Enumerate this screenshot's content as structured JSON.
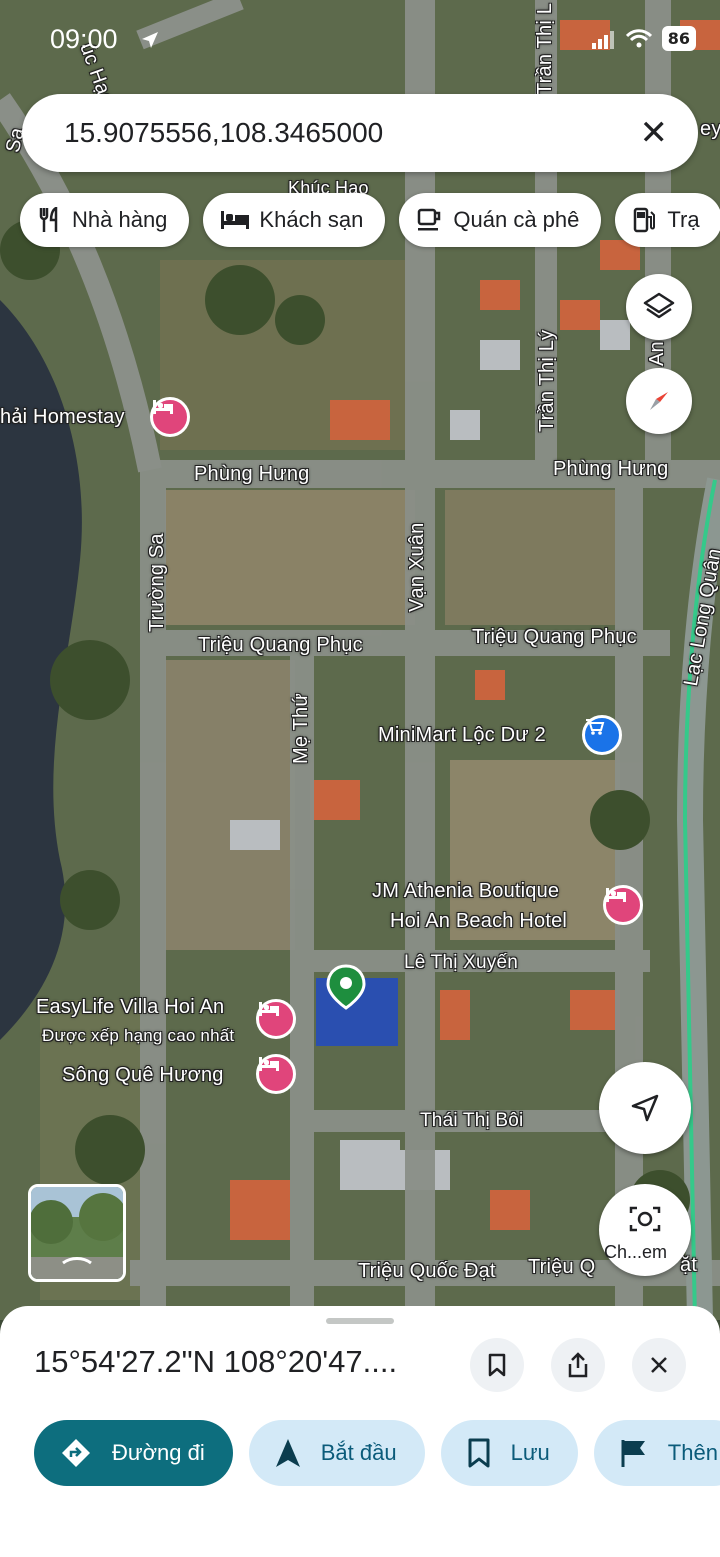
{
  "status_bar": {
    "time": "09:00",
    "battery": "86"
  },
  "search": {
    "value": "15.9075556,108.3465000"
  },
  "chips": [
    {
      "label": "Nhà hàng",
      "icon": "restaurant-icon"
    },
    {
      "label": "Khách sạn",
      "icon": "hotel-icon"
    },
    {
      "label": "Quán cà phê",
      "icon": "coffee-icon"
    },
    {
      "label": "Trạ",
      "icon": "gas-station-icon"
    }
  ],
  "map": {
    "streets": {
      "khuc_hao_top": "úc Hạo",
      "khuc_hao": "Khúc Hạo",
      "truong_sa_top": "Sa",
      "tran_thi_ly_top": "Trần Thị L",
      "tran_thi_ly": "Trần Thị Lý",
      "phung_hung_left": "Phùng Hưng",
      "phung_hung_right": "Phùng Hưng",
      "truong_sa": "Trường Sa",
      "van_xuan": "Vạn Xuân",
      "trieu_quang_phuc_left": "Triệu Quang Phục",
      "trieu_quang_phuc_right": "Triệu Quang Phục",
      "lac_long_quan": "Lạc Long Quân",
      "me_thu": "Mẹ Thứ",
      "le_thi_xuyen": "Lê Thị Xuyến",
      "thai_thi_boi": "Thái Thị Bôi",
      "trieu_quoc_dat": "Triệu Quốc Đạt",
      "trieu_quoc_right": "Triệu Q",
      "right_edge_top": "ey",
      "right_edge_mid": "An",
      "right_edge_bottom": "ặt"
    },
    "pois": {
      "homestay": "hải Homestay",
      "minimart": "MiniMart Lộc Dư 2",
      "jm_line1": "JM Athenia Boutique",
      "jm_line2": "Hoi An Beach Hotel",
      "easylife": "EasyLife Villa Hoi An",
      "easylife_sub": "Được xếp hạng cao nhất",
      "song_que": "Sông Quê Hương"
    },
    "chat_label": "Ch...em"
  },
  "sheet": {
    "coordinates": "15°54'27.2\"N 108°20'47....",
    "actions": [
      {
        "label": "Đường đi",
        "icon": "directions-icon"
      },
      {
        "label": "Bắt đầu",
        "icon": "navigation-arrow-icon"
      },
      {
        "label": "Lưu",
        "icon": "bookmark-icon"
      },
      {
        "label": "Thên",
        "icon": "flag-icon"
      }
    ]
  },
  "colors": {
    "primary": "#0d6e7e",
    "chip_bg": "#d3e9f7",
    "poi_pink": "#e0457b",
    "poi_blue": "#1a73e8",
    "pin_green": "#1e8e3e"
  }
}
